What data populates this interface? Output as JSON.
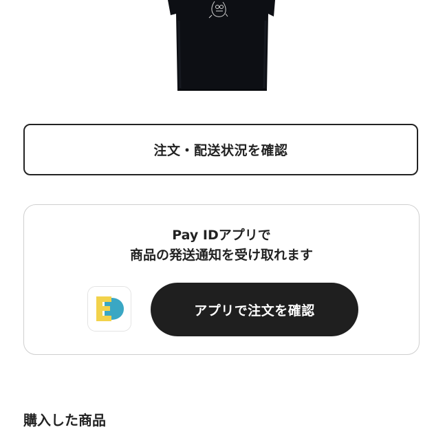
{
  "product": {
    "image_icon": "tshirt-image"
  },
  "order_status_button": {
    "label": "注文・配送状況を確認"
  },
  "payid_card": {
    "message_line1": "Pay IDアプリで",
    "message_line2": "商品の発送通知を受け取れます",
    "app_icon": "pay-id-app-icon",
    "app_button_label": "アプリで注文を確認"
  },
  "purchased_section": {
    "heading": "購入した商品"
  },
  "colors": {
    "text": "#222222",
    "button_dark": "#1f1f1f",
    "card_border": "#cfcfcf",
    "app_icon_yellow": "#f2d24b",
    "app_icon_teal": "#3aa7c4"
  }
}
